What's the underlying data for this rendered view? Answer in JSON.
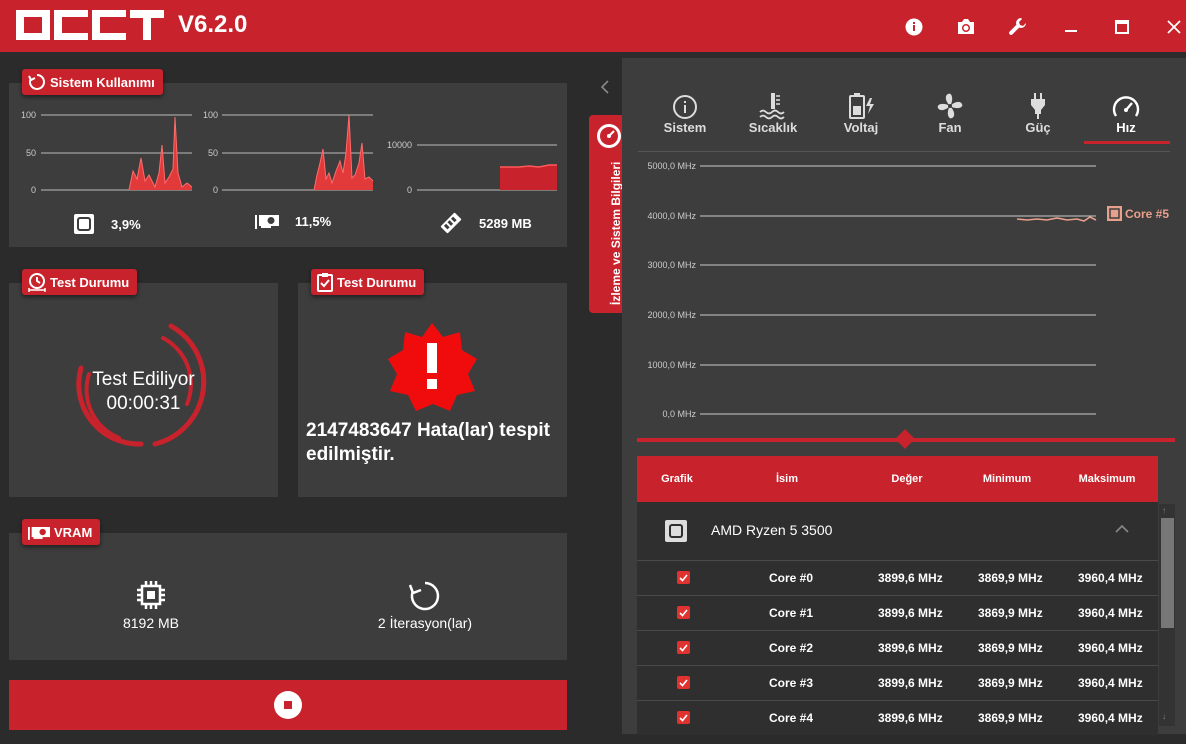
{
  "app": {
    "version": "V6.2.0"
  },
  "sistem": {
    "title": "Sistem Kullanımı",
    "cpu": {
      "value": "3,9%",
      "axis": [
        "100",
        "50",
        "0"
      ],
      "icon": "cpu-square-icon"
    },
    "gpu": {
      "value": "11,5%",
      "axis": [
        "100",
        "50",
        "0"
      ],
      "icon": "gpu-icon"
    },
    "ram": {
      "value": "5289 MB",
      "axis": [
        "10000",
        "0"
      ],
      "icon": "ram-icon"
    }
  },
  "test1": {
    "title": "Test Durumu",
    "status": "Test Ediliyor",
    "time": "00:00:31"
  },
  "test2": {
    "title": "Test Durumu",
    "message": "2147483647 Hata(lar) tespit edilmiştir."
  },
  "vram": {
    "title": "VRAM",
    "size": "8192 MB",
    "iterations": "2 İterasyon(lar)"
  },
  "side_tab": {
    "label": "İzleme ve Sistem Bilgileri"
  },
  "monitor": {
    "tabs": [
      {
        "label": "Sistem",
        "icon": "info-icon"
      },
      {
        "label": "Sıcaklık",
        "icon": "thermometer-icon"
      },
      {
        "label": "Voltaj",
        "icon": "battery-icon"
      },
      {
        "label": "Fan",
        "icon": "fan-icon"
      },
      {
        "label": "Güç",
        "icon": "plug-icon"
      },
      {
        "label": "Hız",
        "icon": "speedometer-icon",
        "active": true
      }
    ],
    "y_labels": [
      "5000,0 MHz",
      "4000,0 MHz",
      "3000,0 MHz",
      "2000,0 MHz",
      "1000,0 MHz",
      "0,0 MHz"
    ],
    "legend": "Core #5",
    "table": {
      "headers": [
        "Grafik",
        "İsim",
        "Değer",
        "Minimum",
        "Maksimum"
      ],
      "group": "AMD Ryzen 5 3500",
      "rows": [
        {
          "name": "Core #0",
          "value": "3899,6 MHz",
          "min": "3869,9 MHz",
          "max": "3960,4 MHz"
        },
        {
          "name": "Core #1",
          "value": "3899,6 MHz",
          "min": "3869,9 MHz",
          "max": "3960,4 MHz"
        },
        {
          "name": "Core #2",
          "value": "3899,6 MHz",
          "min": "3869,9 MHz",
          "max": "3960,4 MHz"
        },
        {
          "name": "Core #3",
          "value": "3899,6 MHz",
          "min": "3869,9 MHz",
          "max": "3960,4 MHz"
        },
        {
          "name": "Core #4",
          "value": "3899,6 MHz",
          "min": "3869,9 MHz",
          "max": "3960,4 MHz"
        }
      ]
    }
  },
  "colors": {
    "accent": "#c8232c",
    "panel": "#3d3d3d",
    "background": "#2b2b2b"
  }
}
